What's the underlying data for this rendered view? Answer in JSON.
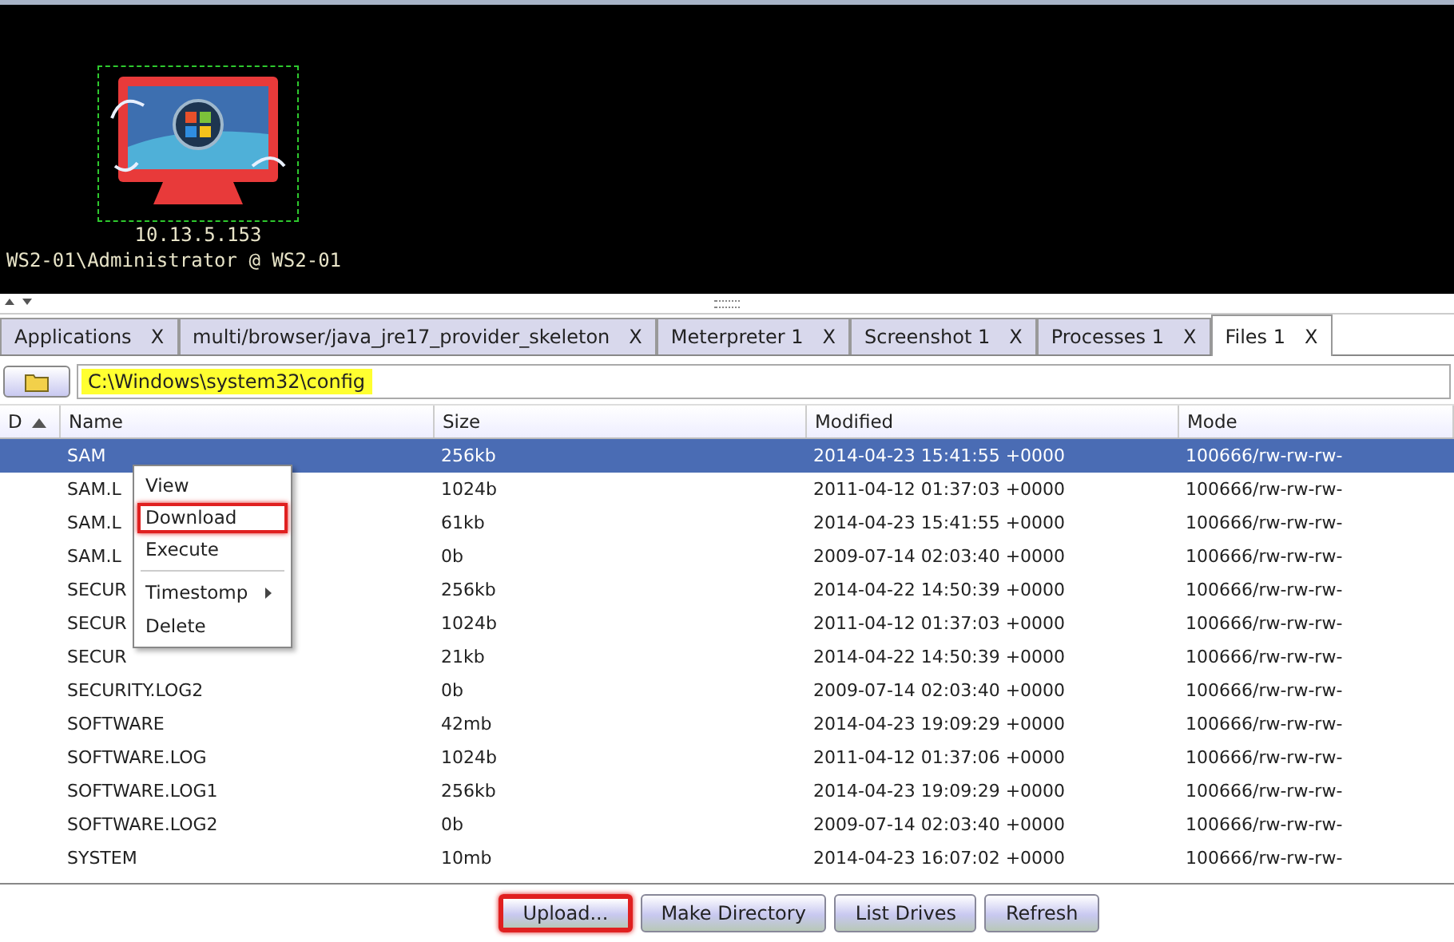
{
  "graph": {
    "hosts": [
      {
        "address": "10.13.5.153",
        "account": "WS2-01\\Administrator @ WS2-01",
        "selected": true,
        "compromised": true
      }
    ]
  },
  "tabs": [
    {
      "label": "Applications",
      "close": "X",
      "selected": false
    },
    {
      "label": "multi/browser/java_jre17_provider_skeleton",
      "close": "X",
      "selected": false
    },
    {
      "label": "Meterpreter 1",
      "close": "X",
      "selected": false
    },
    {
      "label": "Screenshot 1",
      "close": "X",
      "selected": false
    },
    {
      "label": "Processes 1",
      "close": "X",
      "selected": false
    },
    {
      "label": "Files 1",
      "close": "X",
      "selected": true
    }
  ],
  "path": {
    "value": "C:\\Windows\\system32\\config",
    "highlighted": true
  },
  "table": {
    "columns": [
      {
        "label": "D",
        "sorted": true
      },
      {
        "label": "Name",
        "sorted": false
      },
      {
        "label": "Size",
        "sorted": false
      },
      {
        "label": "Modified",
        "sorted": false
      },
      {
        "label": "Mode",
        "sorted": false
      }
    ],
    "rows": [
      {
        "name": "SAM",
        "size": "256kb",
        "modified": "2014-04-23 15:41:55 +0000",
        "mode": "100666/rw-rw-rw-",
        "selected": true
      },
      {
        "name": "SAM.L",
        "size": "1024b",
        "modified": "2011-04-12 01:37:03 +0000",
        "mode": "100666/rw-rw-rw-",
        "selected": false
      },
      {
        "name": "SAM.L",
        "size": "61kb",
        "modified": "2014-04-23 15:41:55 +0000",
        "mode": "100666/rw-rw-rw-",
        "selected": false
      },
      {
        "name": "SAM.L",
        "size": "0b",
        "modified": "2009-07-14 02:03:40 +0000",
        "mode": "100666/rw-rw-rw-",
        "selected": false
      },
      {
        "name": "SECUR",
        "size": "256kb",
        "modified": "2014-04-22 14:50:39 +0000",
        "mode": "100666/rw-rw-rw-",
        "selected": false
      },
      {
        "name": "SECUR",
        "size": "1024b",
        "modified": "2011-04-12 01:37:03 +0000",
        "mode": "100666/rw-rw-rw-",
        "selected": false
      },
      {
        "name": "SECUR",
        "size": "21kb",
        "modified": "2014-04-22 14:50:39 +0000",
        "mode": "100666/rw-rw-rw-",
        "selected": false
      },
      {
        "name": "SECURITY.LOG2",
        "size": "0b",
        "modified": "2009-07-14 02:03:40 +0000",
        "mode": "100666/rw-rw-rw-",
        "selected": false
      },
      {
        "name": "SOFTWARE",
        "size": "42mb",
        "modified": "2014-04-23 19:09:29 +0000",
        "mode": "100666/rw-rw-rw-",
        "selected": false
      },
      {
        "name": "SOFTWARE.LOG",
        "size": "1024b",
        "modified": "2011-04-12 01:37:06 +0000",
        "mode": "100666/rw-rw-rw-",
        "selected": false
      },
      {
        "name": "SOFTWARE.LOG1",
        "size": "256kb",
        "modified": "2014-04-23 19:09:29 +0000",
        "mode": "100666/rw-rw-rw-",
        "selected": false
      },
      {
        "name": "SOFTWARE.LOG2",
        "size": "0b",
        "modified": "2009-07-14 02:03:40 +0000",
        "mode": "100666/rw-rw-rw-",
        "selected": false
      },
      {
        "name": "SYSTEM",
        "size": "10mb",
        "modified": "2014-04-23 16:07:02 +0000",
        "mode": "100666/rw-rw-rw-",
        "selected": false
      }
    ]
  },
  "context_menu": {
    "items": [
      {
        "kind": "item",
        "label": "View",
        "highlighted": false
      },
      {
        "kind": "item",
        "label": "Download",
        "highlighted": true
      },
      {
        "kind": "item",
        "label": "Execute",
        "highlighted": false
      },
      {
        "kind": "separator"
      },
      {
        "kind": "submenu",
        "label": "Timestomp",
        "highlighted": false
      },
      {
        "kind": "item",
        "label": "Delete",
        "highlighted": false
      }
    ]
  },
  "buttons": [
    {
      "label": "Upload...",
      "highlighted": true
    },
    {
      "label": "Make Directory",
      "highlighted": false
    },
    {
      "label": "List Drives",
      "highlighted": false
    },
    {
      "label": "Refresh",
      "highlighted": false
    }
  ]
}
